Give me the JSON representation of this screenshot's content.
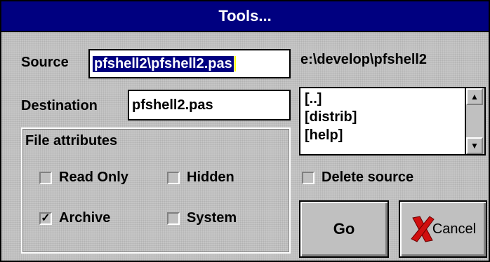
{
  "window": {
    "title": "Tools..."
  },
  "source": {
    "label": "Source",
    "value": "pfshell2\\pfshell2.pas"
  },
  "destination": {
    "label": "Destination",
    "value": "pfshell2.pas"
  },
  "directory": {
    "path": "e:\\develop\\pfshell2",
    "items": [
      "[..]",
      "[distrib]",
      "[help]"
    ]
  },
  "attributes": {
    "title": "File attributes",
    "read_only": {
      "label": "Read Only",
      "checked": false
    },
    "hidden": {
      "label": "Hidden",
      "checked": false
    },
    "archive": {
      "label": "Archive",
      "checked": true
    },
    "system": {
      "label": "System",
      "checked": false
    }
  },
  "delete_source": {
    "label": "Delete source",
    "checked": false
  },
  "buttons": {
    "go": "Go",
    "cancel": "Cancel"
  },
  "icons": {
    "check": "✓",
    "scroll_up": "▲",
    "scroll_down": "▼"
  },
  "colors": {
    "title_bg": "#000080",
    "selection": "#000080",
    "cancel_x": "#d11010"
  }
}
